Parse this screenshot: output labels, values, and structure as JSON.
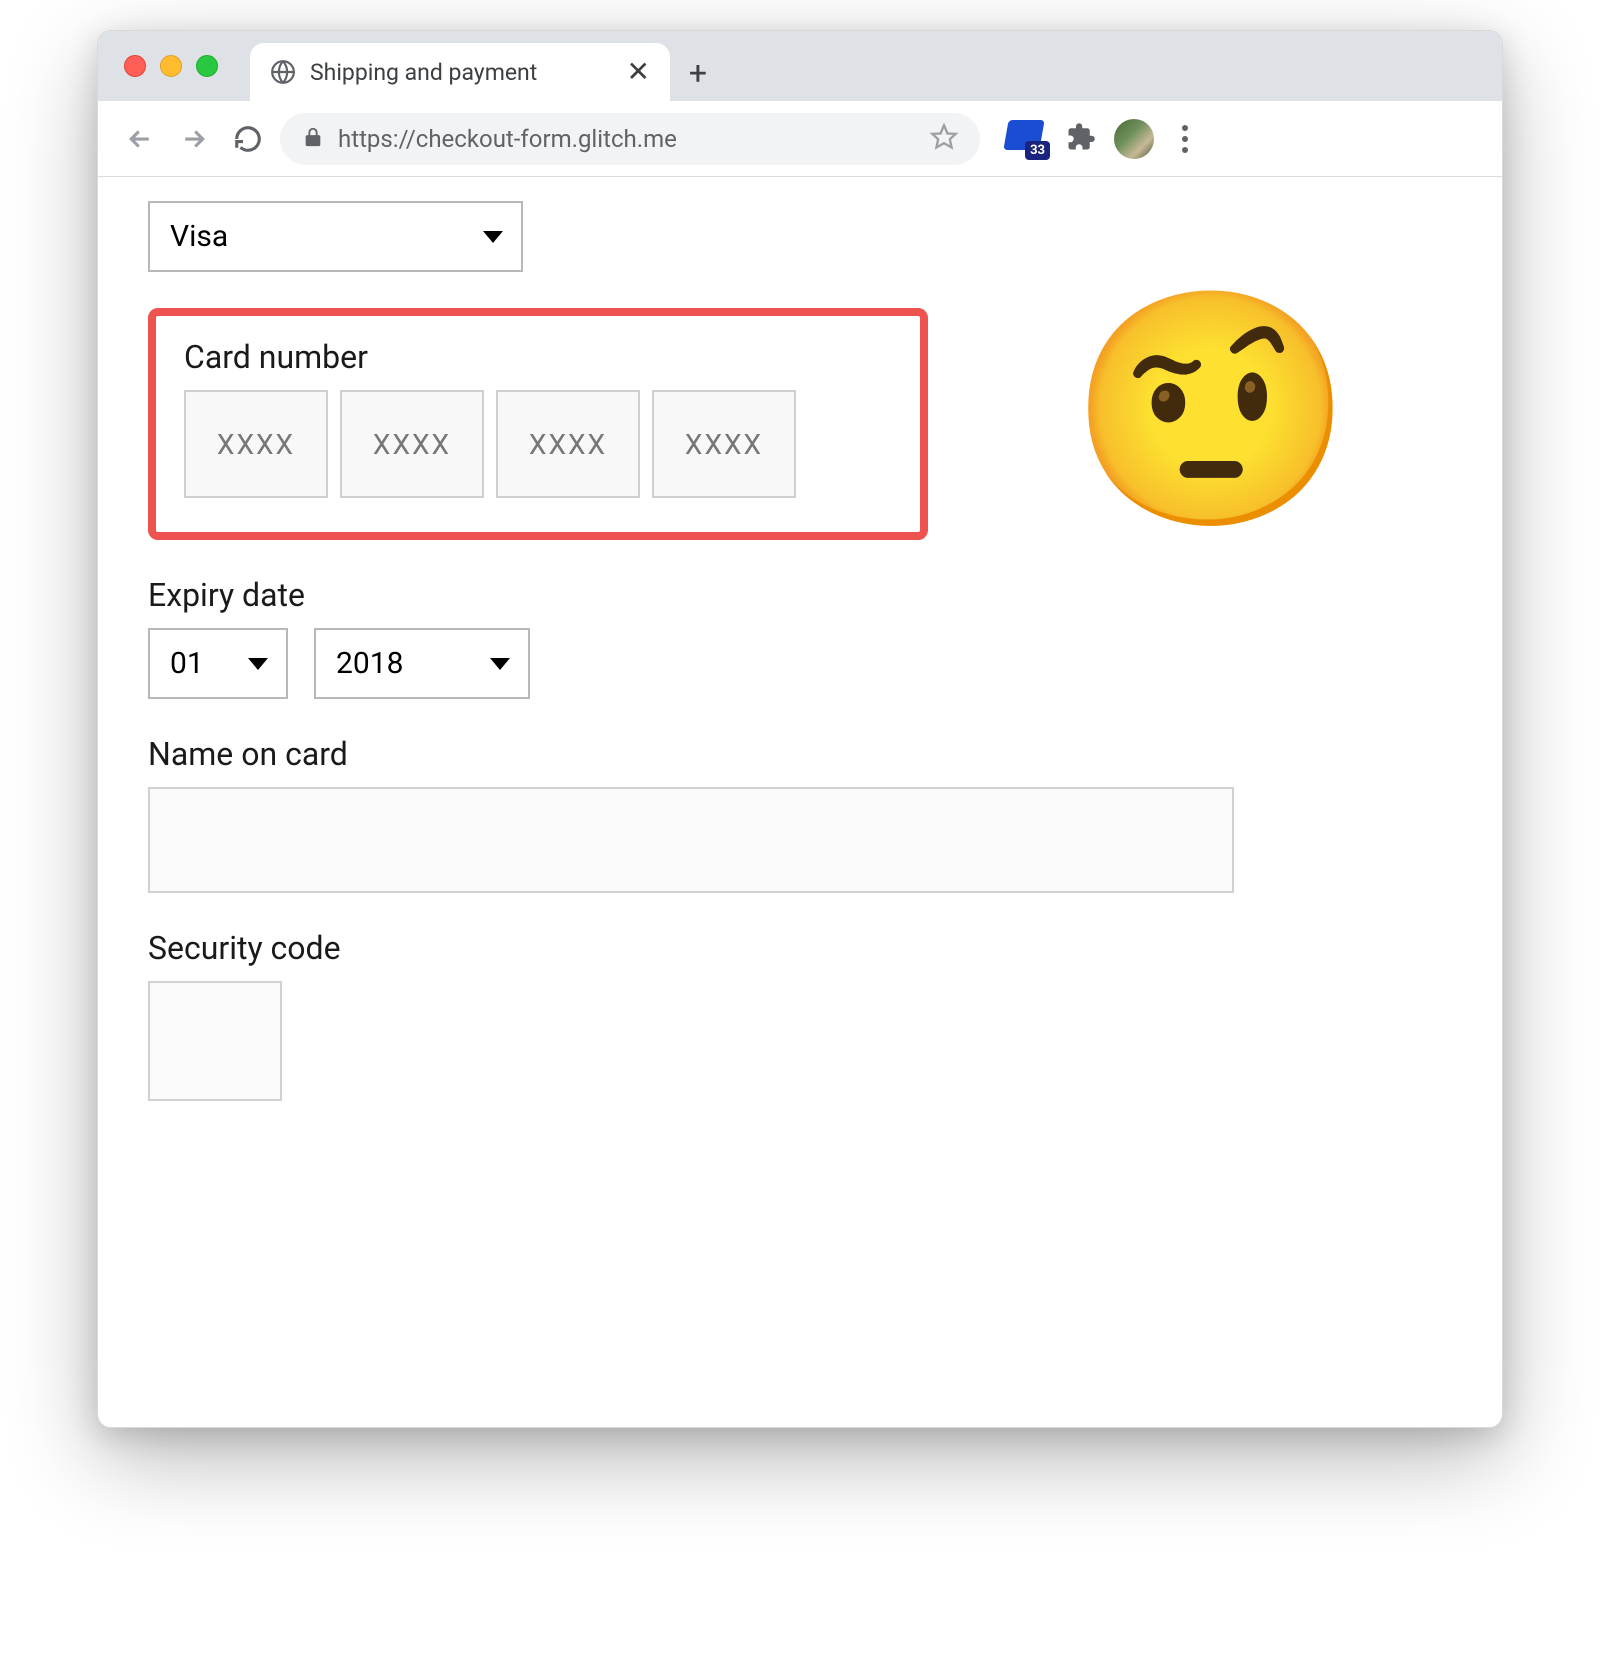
{
  "browser": {
    "tab_title": "Shipping and payment",
    "url": "https://checkout-form.glitch.me",
    "extension_badge_count": "33"
  },
  "form": {
    "card_type": {
      "selected": "Visa"
    },
    "card_number": {
      "label": "Card number",
      "placeholder": "XXXX"
    },
    "expiry": {
      "label": "Expiry date",
      "month_selected": "01",
      "year_selected": "2018"
    },
    "name_on_card": {
      "label": "Name on card",
      "value": ""
    },
    "security_code": {
      "label": "Security code",
      "value": ""
    }
  },
  "annotation": {
    "emoji": "🤨",
    "highlight_color": "#ef5350"
  }
}
